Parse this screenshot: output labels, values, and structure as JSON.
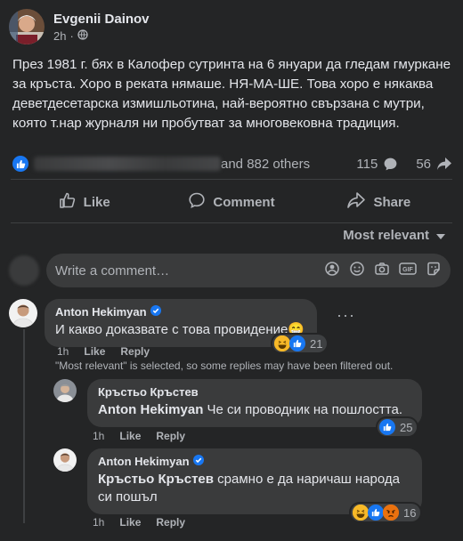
{
  "post": {
    "author": "Evgenii Dainov",
    "time": "2h",
    "privacy_icon": "globe-icon",
    "text": "През 1981 г. бях в Калофер сутринта на 6 януари да гледам гмуркане за кръста. Хоро в реката нямаше. НЯ-МА-ШЕ. Това хоро е някаква деветдесетарска измишльотина, най-вероятно свързана с мутри, която т.нар журналя ни пробутват за многовековна традиция."
  },
  "reactions": {
    "others_text": "and 882 others",
    "comments_count": "115",
    "shares_count": "56"
  },
  "actions": {
    "like": "Like",
    "comment": "Comment",
    "share": "Share"
  },
  "sort": {
    "label": "Most relevant"
  },
  "composer": {
    "placeholder": "Write a comment…"
  },
  "comments": [
    {
      "author": "Anton Hekimyan",
      "verified": true,
      "text": "И какво доказвате с това провидение😁",
      "time": "1h",
      "like": "Like",
      "reply": "Reply",
      "reaction_count": "21"
    }
  ],
  "filter_notice": "\"Most relevant\" is selected, so some replies may have been filtered out.",
  "replies": [
    {
      "author": "Кръстьо Кръстев",
      "mention": "Anton Hekimyan",
      "text": " Че си проводник на пошлостта.",
      "time": "1h",
      "like": "Like",
      "reply": "Reply",
      "reaction_count": "25"
    },
    {
      "author": "Anton Hekimyan",
      "verified": true,
      "mention": "Кръстьо Кръстев",
      "text": " срамно е да наричаш народа си пошъл",
      "time": "1h",
      "like": "Like",
      "reply": "Reply",
      "reaction_count": "16"
    }
  ],
  "colors": {
    "background": "#242526",
    "bubble": "#3a3b3c",
    "accent": "#1877f2",
    "text": "#e4e6eb",
    "secondary_text": "#b0b3b8"
  }
}
